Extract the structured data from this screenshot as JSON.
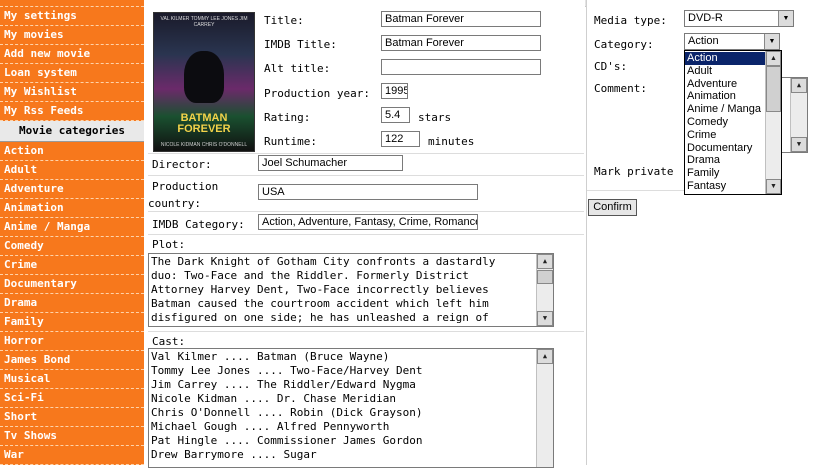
{
  "sidebar": {
    "menu": [
      "My settings",
      "My movies",
      "Add new movie",
      "Loan system",
      "My Wishlist",
      "My Rss Feeds"
    ],
    "categories_header": "Movie categories",
    "categories": [
      "Action",
      "Adult",
      "Adventure",
      "Animation",
      "Anime / Manga",
      "Comedy",
      "Crime",
      "Documentary",
      "Drama",
      "Family",
      "Horror",
      "James Bond",
      "Musical",
      "Sci-Fi",
      "Short",
      "Tv Shows",
      "War"
    ]
  },
  "poster": {
    "names": "VAL KILMER  TOMMY LEE JONES  JIM CARREY",
    "title_line1": "BATMAN",
    "title_line2": "FOREVER",
    "bottom": "NICOLE KIDMAN  CHRIS O'DONNELL"
  },
  "form": {
    "title_label": "Title:",
    "title_value": "Batman Forever",
    "imdb_title_label": "IMDB Title:",
    "imdb_title_value": "Batman Forever",
    "alt_title_label": "Alt title:",
    "alt_title_value": "",
    "year_label": "Production year:",
    "year_value": "1995",
    "rating_label": "Rating:",
    "rating_value": "5.4",
    "rating_unit": "stars",
    "runtime_label": "Runtime:",
    "runtime_value": "122",
    "runtime_unit": "minutes",
    "director_label": "Director:",
    "director_value": "Joel Schumacher",
    "country_label_1": "Production",
    "country_label_2": "country:",
    "country_value": "USA",
    "imdb_category_label": "IMDB Category:",
    "imdb_category_value": "Action, Adventure, Fantasy, Crime, Romance,",
    "plot_label": "Plot:",
    "plot_lines": [
      "The Dark Knight of Gotham City confronts a dastardly",
      "duo: Two-Face and the Riddler. Formerly District",
      "Attorney Harvey Dent, Two-Face incorrectly believes",
      "Batman caused the courtroom accident which left him",
      "disfigured on one side; he has unleashed a reign of"
    ],
    "cast_label": "Cast:",
    "cast_lines": [
      "Val Kilmer .... Batman (Bruce Wayne)",
      "Tommy Lee Jones .... Two-Face/Harvey Dent",
      "Jim Carrey .... The Riddler/Edward Nygma",
      "Nicole Kidman .... Dr. Chase Meridian",
      "Chris O'Donnell .... Robin (Dick Grayson)",
      "Michael Gough .... Alfred Pennyworth",
      "Pat Hingle .... Commissioner James Gordon",
      "Drew Barrymore .... Sugar"
    ]
  },
  "right": {
    "media_type_label": "Media type:",
    "media_type_value": "DVD-R",
    "category_label": "Category:",
    "category_value": "Action",
    "cds_label": "CD's:",
    "comment_label": "Comment:",
    "private_label": "Mark private",
    "confirm_label": "Confirm",
    "dropdown_options": [
      "Action",
      "Adult",
      "Adventure",
      "Animation",
      "Anime / Manga",
      "Comedy",
      "Crime",
      "Documentary",
      "Drama",
      "Family",
      "Fantasy"
    ]
  },
  "colors": {
    "sidebar": "#f7781c",
    "selected_option": "#0a246a"
  }
}
